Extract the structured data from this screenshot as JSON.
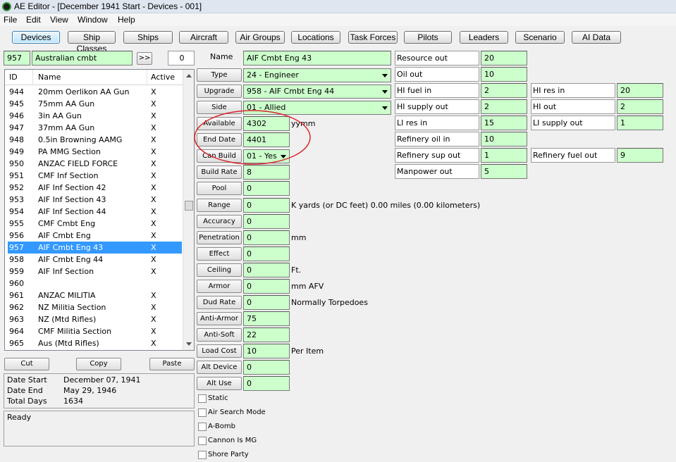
{
  "window": {
    "title": "AE Editor - [December 1941 Start - Devices - 001]"
  },
  "menu": [
    "File",
    "Edit",
    "View",
    "Window",
    "Help"
  ],
  "tabs": [
    "Devices",
    "Ship Classes",
    "Ships",
    "Aircraft",
    "Air Groups",
    "Locations",
    "Task Forces",
    "Pilots",
    "Leaders",
    "Scenario",
    "AI Data"
  ],
  "nation": {
    "code": "957",
    "name": "Australian cmbt",
    "nav_button": ">>",
    "count": "0"
  },
  "list": {
    "headers": [
      "ID",
      "Name",
      "Active"
    ],
    "rows": [
      [
        "944",
        "20mm Oerlikon AA Gun",
        "X"
      ],
      [
        "945",
        "75mm AA Gun",
        "X"
      ],
      [
        "946",
        "3in AA Gun",
        "X"
      ],
      [
        "947",
        "37mm AA Gun",
        "X"
      ],
      [
        "948",
        "0.5in Browning AAMG",
        "X"
      ],
      [
        "949",
        "PA MMG Section",
        "X"
      ],
      [
        "950",
        "ANZAC FIELD FORCE",
        "X"
      ],
      [
        "951",
        "CMF Inf Section",
        "X"
      ],
      [
        "952",
        "AIF Inf Section 42",
        "X"
      ],
      [
        "953",
        "AIF Inf Section 43",
        "X"
      ],
      [
        "954",
        "AIF Inf Section 44",
        "X"
      ],
      [
        "955",
        "CMF Cmbt Eng",
        "X"
      ],
      [
        "956",
        "AIF Cmbt Eng",
        "X"
      ],
      [
        "957",
        "AIF Cmbt Eng 43",
        "X"
      ],
      [
        "958",
        "AIF Cmbt Eng 44",
        "X"
      ],
      [
        "959",
        "AIF Inf Section",
        "X"
      ],
      [
        "960",
        "",
        ""
      ],
      [
        "961",
        "ANZAC MILITIA",
        "X"
      ],
      [
        "962",
        "NZ Militia Section",
        "X"
      ],
      [
        "963",
        "NZ (Mtd Rifles)",
        "X"
      ],
      [
        "964",
        "CMF Militia Section",
        "X"
      ],
      [
        "965",
        "Aus (Mtd Rifles)",
        "X"
      ]
    ]
  },
  "edit_buttons": {
    "cut": "Cut",
    "copy": "Copy",
    "paste": "Paste"
  },
  "dates": {
    "start_label": "Date Start",
    "start_value": "December 07, 1941",
    "end_label": "Date End",
    "end_value": "May 29, 1946",
    "days_label": "Total Days",
    "days_value": "1634"
  },
  "status": "Ready",
  "device": {
    "name_label": "Name",
    "name_value": "AIF Cmbt Eng 43",
    "type_label": "Type",
    "type_value": "24 - Engineer",
    "upgrade_label": "Upgrade",
    "upgrade_value": "958 - AIF Cmbt Eng 44",
    "side_label": "Side",
    "side_value": "01 - Allied",
    "available_label": "Available",
    "available_value": "4302",
    "available_unit": "yymm",
    "end_date_label": "End Date",
    "end_date_value": "4401",
    "can_build_label": "Can Build",
    "can_build_value": "01 - Yes",
    "build_rate_label": "Build Rate",
    "build_rate_value": "8",
    "pool_label": "Pool",
    "pool_value": "0",
    "range_label": "Range",
    "range_value": "0",
    "range_unit": "K yards  (or DC feet)  0.00 miles  (0.00 kilometers)",
    "accuracy_label": "Accuracy",
    "accuracy_value": "0",
    "penetration_label": "Penetration",
    "penetration_value": "0",
    "penetration_unit": "mm",
    "effect_label": "Effect",
    "effect_value": "0",
    "ceiling_label": "Ceiling",
    "ceiling_value": "0",
    "ceiling_unit": "Ft.",
    "armor_label": "Armor",
    "armor_value": "0",
    "armor_unit": "mm AFV",
    "dud_rate_label": "Dud Rate",
    "dud_rate_value": "0",
    "dud_rate_unit": "Normally Torpedoes",
    "anti_armor_label": "Anti-Armor",
    "anti_armor_value": "75",
    "anti_soft_label": "Anti-Soft",
    "anti_soft_value": "22",
    "load_cost_label": "Load Cost",
    "load_cost_value": "10",
    "load_cost_unit": "Per Item",
    "alt_device_label": "Alt Device",
    "alt_device_value": "0",
    "alt_use_label": "Alt Use",
    "alt_use_value": "0"
  },
  "flags": [
    "Static",
    "Air Search Mode",
    "A-Bomb",
    "Cannon Is MG",
    "Shore Party"
  ],
  "resources": {
    "resource_out_label": "Resource out",
    "resource_out_value": "20",
    "oil_out_label": "Oil out",
    "oil_out_value": "10",
    "hi_fuel_in_label": "HI fuel in",
    "hi_fuel_in_value": "2",
    "hi_res_in_label": "HI res in",
    "hi_res_in_value": "20",
    "hi_supply_out_label": "HI supply out",
    "hi_supply_out_value": "2",
    "hi_out_label": "HI out",
    "hi_out_value": "2",
    "li_res_in_label": "LI res in",
    "li_res_in_value": "15",
    "li_supply_out_label": "LI supply out",
    "li_supply_out_value": "1",
    "refinery_oil_in_label": "Refinery oil in",
    "refinery_oil_in_value": "10",
    "refinery_sup_out_label": "Refinery sup out",
    "refinery_sup_out_value": "1",
    "refinery_fuel_out_label": "Refinery fuel out",
    "refinery_fuel_out_value": "9",
    "manpower_out_label": "Manpower out",
    "manpower_out_value": "5"
  },
  "colors": {
    "field_green": "#ccffcc",
    "selection_blue": "#3399ff",
    "annotation_red": "#d9262c"
  }
}
